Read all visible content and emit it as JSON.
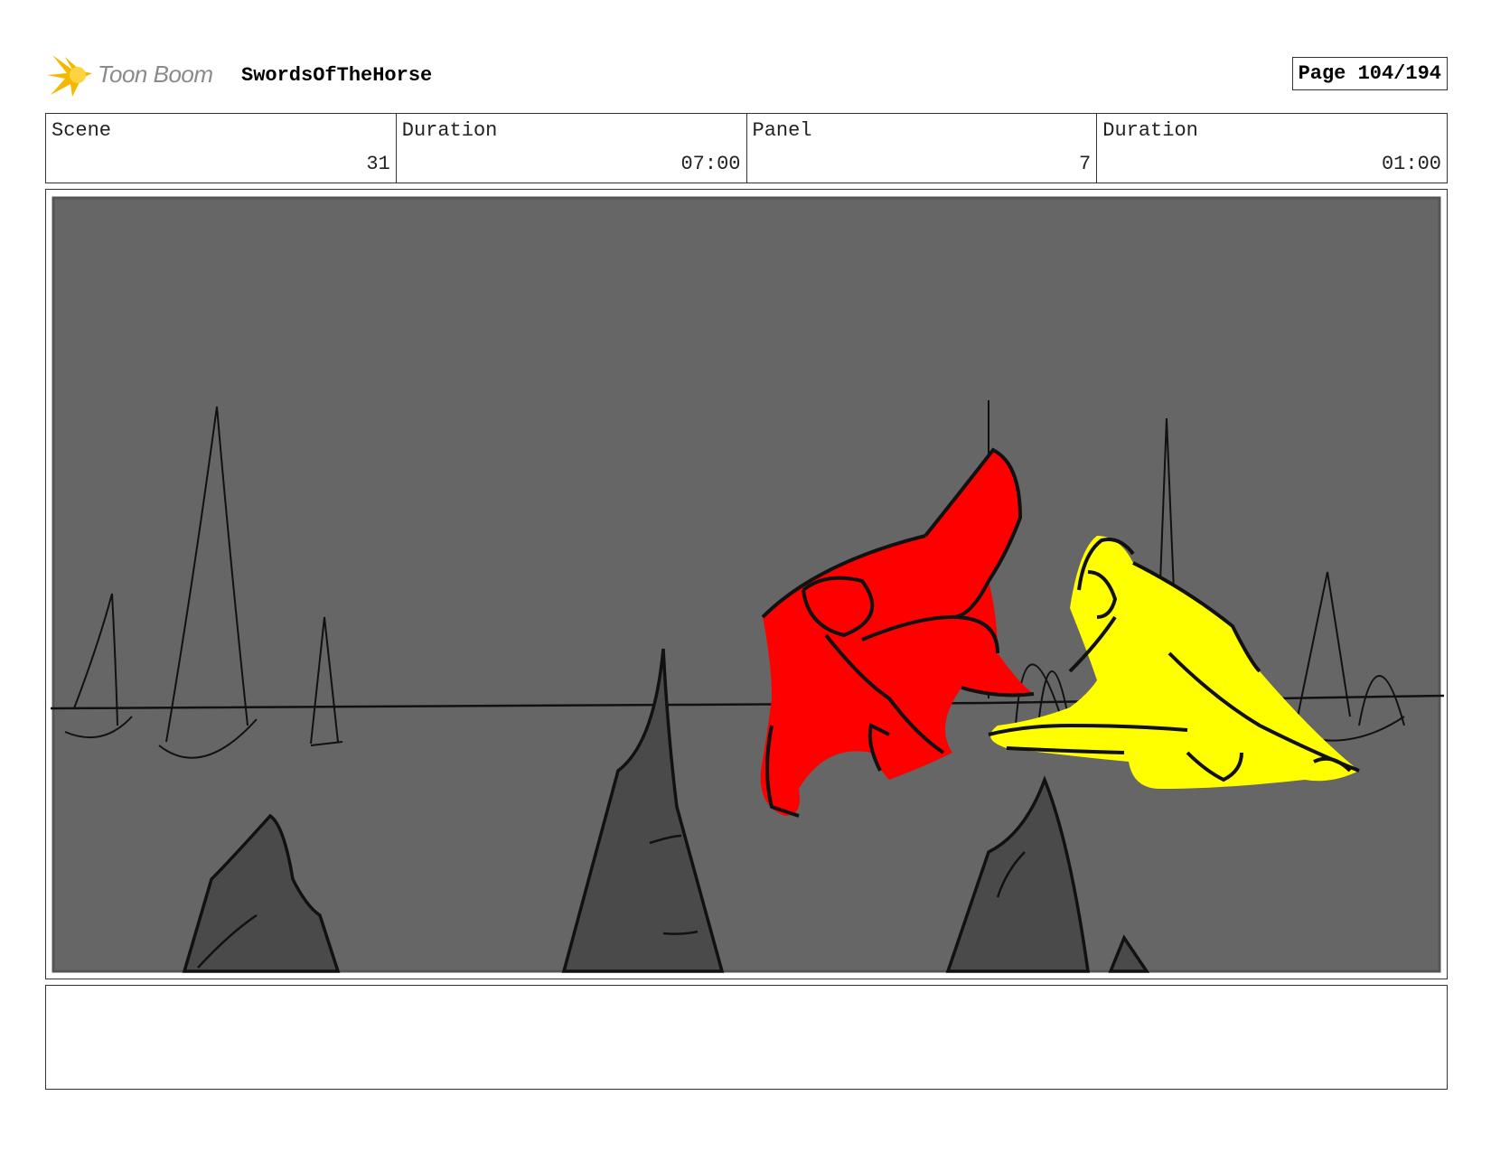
{
  "header": {
    "brand": "Toon Boom",
    "project_title": "SwordsOfTheHorse",
    "page_label": "Page 104/194"
  },
  "info": {
    "scene_label": "Scene",
    "scene_value": "31",
    "scene_duration_label": "Duration",
    "scene_duration_value": "07:00",
    "panel_label": "Panel",
    "panel_value": "7",
    "panel_duration_label": "Duration",
    "panel_duration_value": "01:00"
  },
  "colors": {
    "sky": "#666666",
    "rock": "#4a4a4a",
    "red_figure": "#ff0000",
    "yellow_figure": "#ffff00",
    "logo_accent": "#f5b800"
  },
  "notes": ""
}
